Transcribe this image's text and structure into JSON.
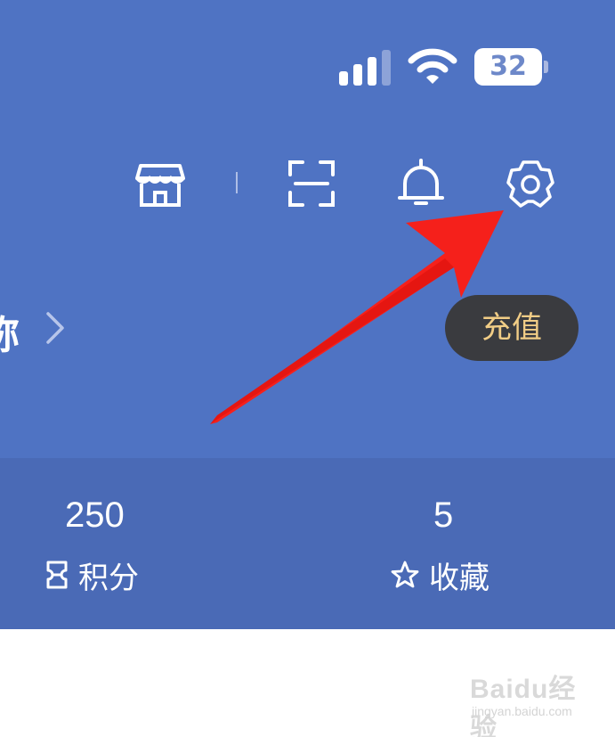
{
  "status_bar": {
    "battery_level": "32",
    "signal_icon": "cellular-signal-icon",
    "wifi_icon": "wifi-icon"
  },
  "toolbar": {
    "icons": [
      "store-icon",
      "scan-icon",
      "bell-icon",
      "gear-icon"
    ]
  },
  "profile": {
    "name_fragment": "称",
    "chevron_icon": "chevron-right-icon"
  },
  "recharge": {
    "label": "充值"
  },
  "stats": {
    "points": {
      "value": "250",
      "label": "积分",
      "icon": "ticket-icon"
    },
    "favorites": {
      "value": "5",
      "label": "收藏",
      "icon": "star-icon"
    }
  },
  "watermark": {
    "main": "Baidu经验",
    "sub": "jingyan.baidu.com"
  },
  "colors": {
    "header_bg": "#4f73c3",
    "stats_bg": "#4a6ab6",
    "tooltip_bg": "#3a3b3f",
    "tooltip_text": "#f1cd86",
    "arrow": "#f5201b"
  }
}
